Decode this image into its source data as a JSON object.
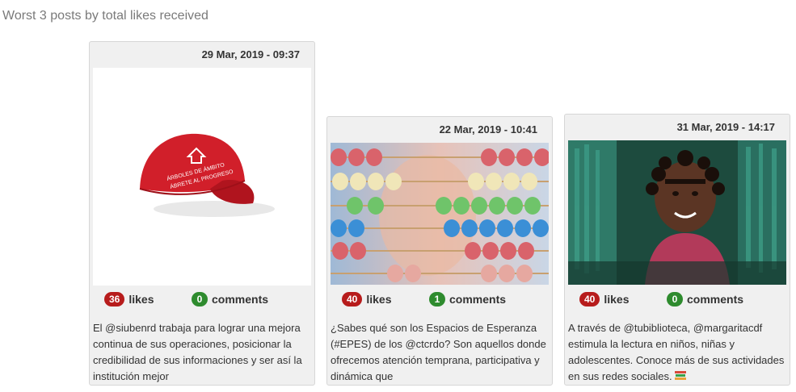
{
  "heading": "Worst 3 posts by total likes received",
  "likes_word": "likes",
  "comments_word": "comments",
  "posts": [
    {
      "date": "29 Mar, 2019 - 09:37",
      "likes": "36",
      "comments": "0",
      "caption": "El @siubenrd trabaja para lograr una mejora continua de sus operaciones, posicionar la credibilidad de sus informaciones y ser así la institución mejor",
      "image": "red-cap-photo"
    },
    {
      "date": "22 Mar, 2019 - 10:41",
      "likes": "40",
      "comments": "1",
      "caption": "¿Sabes qué son los Espacios de Esperanza (#EPES) de los @ctcrdo? Son aquellos donde ofrecemos atención temprana, participativa y dinámica que",
      "image": "abacus-child-photo"
    },
    {
      "date": "31 Mar, 2019 - 14:17",
      "likes": "40",
      "comments": "0",
      "caption": "A través de @tubiblioteca, @margaritacdf estimula la lectura en niños, niñas y adolescentes. Conoce más de sus actividades en sus redes sociales.",
      "image": "girl-bookshelf-photo"
    }
  ],
  "colors": {
    "likes_badge": "#b71c1c",
    "comments_badge": "#2e8b2e"
  }
}
